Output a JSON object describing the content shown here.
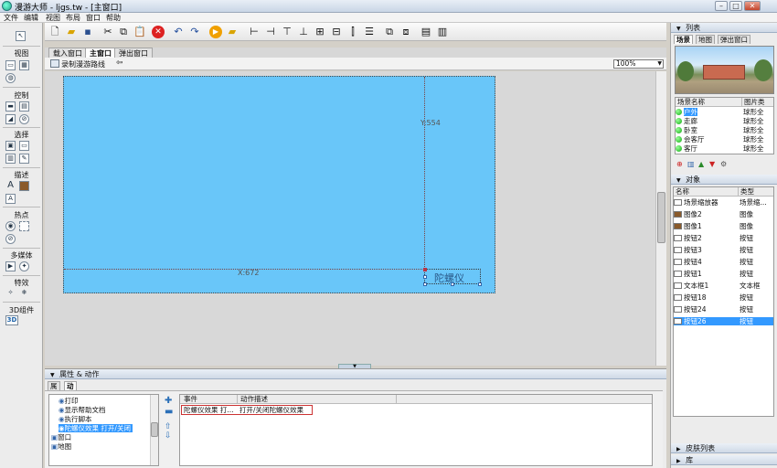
{
  "window": {
    "title": "漫游大师 - ljgs.tw - [主窗口]",
    "controls": [
      "–",
      "□",
      "✕"
    ]
  },
  "menu": [
    "文件",
    "编辑",
    "视图",
    "布局",
    "窗口",
    "帮助"
  ],
  "toolbox": {
    "sections": [
      "视图",
      "控制",
      "选择",
      "描述",
      "热点",
      "多媒体",
      "特效",
      "3D组件"
    ]
  },
  "toolbar": {
    "icons": [
      "new-icon",
      "open-icon",
      "save-icon",
      "cut-icon",
      "copy-icon",
      "paste-icon",
      "delete-icon",
      "undo-icon",
      "redo-icon",
      "run-icon",
      "export-icon",
      "align-left-icon",
      "align-center-icon",
      "align-right-icon",
      "align-top-icon",
      "align-middle-icon",
      "align-bottom-icon",
      "distribute-h-icon",
      "distribute-v-icon",
      "bring-front-icon",
      "send-back-icon",
      "same-width-icon",
      "same-height-icon"
    ]
  },
  "tabs": [
    "载入窗口",
    "主窗口",
    "弹出窗口"
  ],
  "subbar": {
    "record_label": "录制漫游路线",
    "zoom": "100%"
  },
  "canvas": {
    "y_label": "Y:554",
    "x_label": "X:672",
    "widget_text": "陀螺仪"
  },
  "bottom": {
    "title": "属性 & 动作",
    "tabs": [
      "属性",
      "动作"
    ],
    "actions_tree": [
      "打印",
      "显示帮助文档",
      "执行脚本",
      "陀螺仪效果 打开/关闭",
      "窗口",
      "地图"
    ],
    "table_headers": [
      "事件",
      "动作描述"
    ],
    "table_rows": [
      {
        "event": "陀螺仪效果 打...",
        "desc": "打开/关闭陀螺仪效果"
      }
    ]
  },
  "right": {
    "list_title": "列表",
    "list_tabs": [
      "场景",
      "地图",
      "弹出窗口"
    ],
    "scene_headers": [
      "场景名称",
      "图片类"
    ],
    "scenes": [
      {
        "name": "户外",
        "type": "球形全"
      },
      {
        "name": "走廊",
        "type": "球形全"
      },
      {
        "name": "卧室",
        "type": "球形全"
      },
      {
        "name": "会客厅",
        "type": "球形全"
      },
      {
        "name": "客厅",
        "type": "球形全"
      }
    ],
    "objects_title": "对象",
    "object_headers": [
      "名称",
      "类型"
    ],
    "objects": [
      {
        "name": "场景缩放器",
        "type": "场景缩..."
      },
      {
        "name": "图像2",
        "type": "图像"
      },
      {
        "name": "图像1",
        "type": "图像"
      },
      {
        "name": "按钮2",
        "type": "按钮"
      },
      {
        "name": "按钮3",
        "type": "按钮"
      },
      {
        "name": "按钮4",
        "type": "按钮"
      },
      {
        "name": "按钮1",
        "type": "按钮"
      },
      {
        "name": "文本框1",
        "type": "文本框"
      },
      {
        "name": "按钮18",
        "type": "按钮"
      },
      {
        "name": "按钮24",
        "type": "按钮"
      },
      {
        "name": "按钮26",
        "type": "按钮"
      }
    ],
    "bottom_sections": [
      "皮肤列表",
      "库"
    ]
  },
  "colors": {
    "canvas_blue": "#69c6f9",
    "selection": "#3399ff",
    "row_highlight_border": "#cc3333"
  }
}
